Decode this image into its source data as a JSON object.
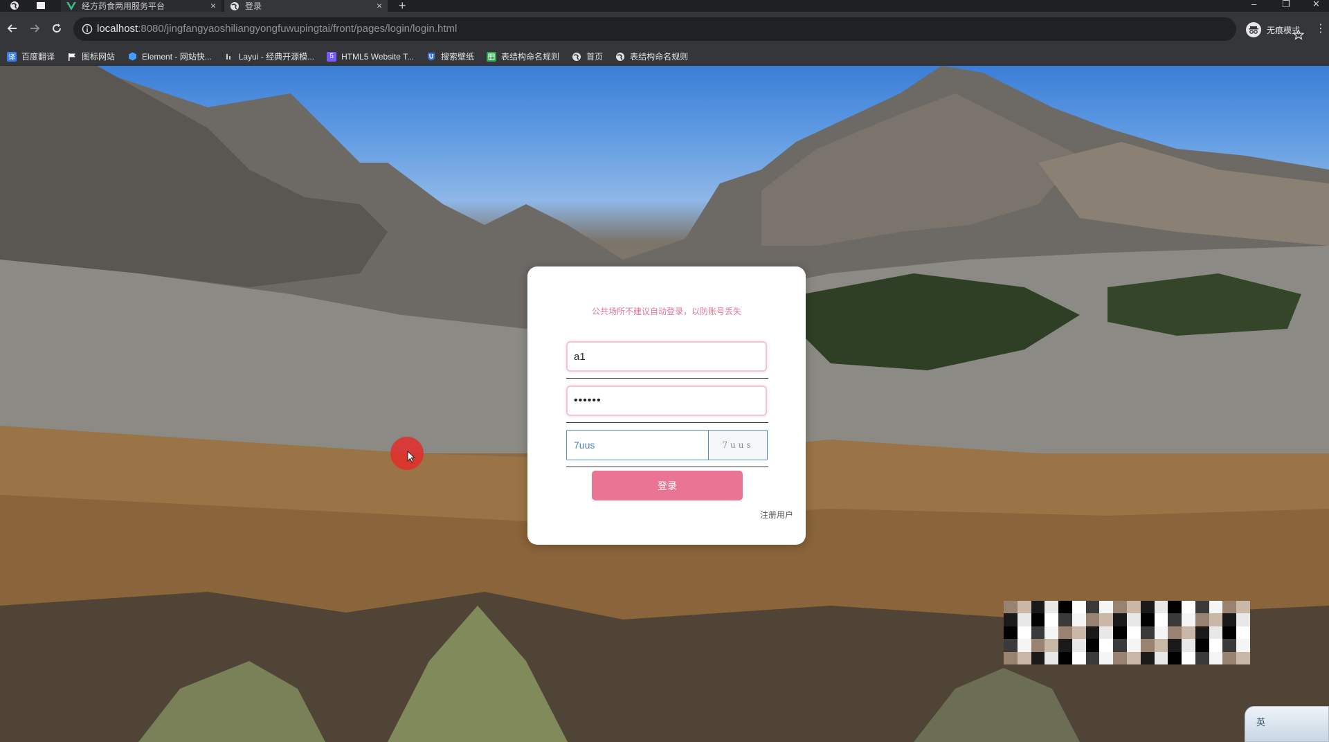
{
  "browser": {
    "tabs": [
      {
        "title": "经方药食两用服务平台",
        "active": false
      },
      {
        "title": "登录",
        "active": true
      }
    ],
    "address": {
      "host": "localhost",
      "path": ":8080/jingfangyaoshiliangyongfuwupingtai/front/pages/login/login.html"
    },
    "profile_label": "无痕模式",
    "bookmarks": [
      {
        "label": "百度翻译",
        "icon": "baidu-translate-icon",
        "color": "#3b7cf2"
      },
      {
        "label": "图标网站",
        "icon": "flag-icon",
        "color": "#ffffff"
      },
      {
        "label": "Element - 网站快...",
        "icon": "element-hexagon-icon",
        "color": "#409eff"
      },
      {
        "label": "Layui - 经典开源模...",
        "icon": "layui-icon",
        "color": "#cfcfcf"
      },
      {
        "label": "HTML5 Website T...",
        "icon": "html5-badge-icon",
        "color": "#7a5af8"
      },
      {
        "label": "搜索壁纸",
        "icon": "u-shield-icon",
        "color": "#3b6fd9"
      },
      {
        "label": "表结构命名规则",
        "icon": "green-table-icon",
        "color": "#2fa84f"
      },
      {
        "label": "首页",
        "icon": "globe-icon",
        "color": "#e0e0e0"
      },
      {
        "label": "表结构命名规则",
        "icon": "globe-icon",
        "color": "#e0e0e0"
      }
    ]
  },
  "login": {
    "notice": "公共场所不建议自动登录，以防账号丢失",
    "username_value": "a1",
    "password_value": "••••••",
    "captcha_value": "7uus",
    "captcha_image_text": "7uus",
    "submit_label": "登录",
    "register_label": "注册用户"
  },
  "colors": {
    "accent_pink": "#e97493",
    "notice_pink": "#e07a93",
    "captcha_blue": "#4a90d9"
  },
  "ime_label": "英"
}
